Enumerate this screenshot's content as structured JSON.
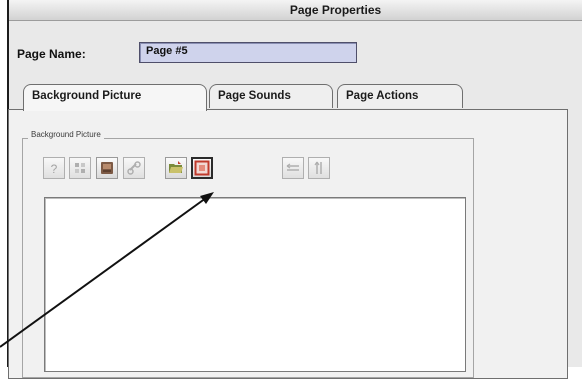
{
  "window": {
    "title": "Page Properties"
  },
  "page_name": {
    "label": "Page Name:",
    "value": "Page #5"
  },
  "tabs": [
    {
      "label": "Background Picture",
      "active": true
    },
    {
      "label": "Page Sounds",
      "active": false
    },
    {
      "label": "Page Actions",
      "active": false
    }
  ],
  "background_group": {
    "label": "Background Picture"
  },
  "toolbar": {
    "buttons": [
      {
        "icon": "question-icon",
        "enabled": false
      },
      {
        "icon": "palette-icon",
        "enabled": false
      },
      {
        "icon": "picture-icon",
        "enabled": true
      },
      {
        "icon": "link-icon",
        "enabled": false
      },
      {
        "icon": "open-folder-icon",
        "enabled": true
      },
      {
        "icon": "red-frame-icon",
        "enabled": true,
        "highlighted": true
      },
      {
        "icon": "align-horizontal-icon",
        "enabled": false
      },
      {
        "icon": "align-vertical-icon",
        "enabled": false
      }
    ]
  }
}
